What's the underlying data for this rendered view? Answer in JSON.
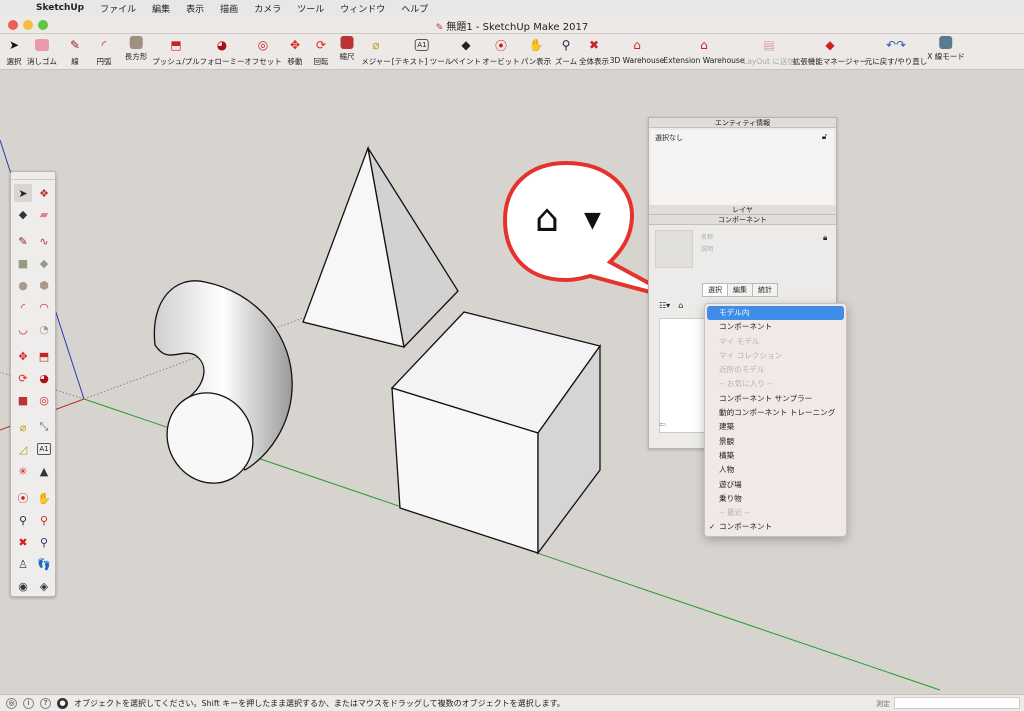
{
  "menubar": {
    "app": "SketchUp",
    "items": [
      "ファイル",
      "編集",
      "表示",
      "描画",
      "カメラ",
      "ツール",
      "ウィンドウ",
      "ヘルプ"
    ]
  },
  "window": {
    "title": "無題1 - SketchUp Make 2017"
  },
  "toolbar": {
    "tools": [
      {
        "label": "選択",
        "icon": "select-arrow-icon"
      },
      {
        "label": "消しゴム",
        "icon": "eraser-icon"
      },
      {
        "label": "線",
        "icon": "pencil-icon"
      },
      {
        "label": "円弧",
        "icon": "arc-icon"
      },
      {
        "label": "長方形",
        "icon": "rectangle-icon"
      },
      {
        "label": "プッシュ/プル",
        "icon": "push-pull-icon"
      },
      {
        "label": "フォローミー",
        "icon": "follow-me-icon"
      },
      {
        "label": "オフセット",
        "icon": "offset-icon"
      },
      {
        "label": "移動",
        "icon": "move-icon"
      },
      {
        "label": "回転",
        "icon": "rotate-icon"
      },
      {
        "label": "縮尺",
        "icon": "scale-icon"
      },
      {
        "label": "メジャー",
        "icon": "tape-measure-icon"
      },
      {
        "label": "[テキスト] ツール",
        "icon": "text-tool-icon"
      },
      {
        "label": "ペイント",
        "icon": "paint-bucket-icon"
      },
      {
        "label": "オービット",
        "icon": "orbit-icon"
      },
      {
        "label": "パン表示",
        "icon": "pan-icon"
      },
      {
        "label": "ズーム",
        "icon": "zoom-icon"
      },
      {
        "label": "全体表示",
        "icon": "zoom-extents-icon"
      },
      {
        "label": "3D Warehouse",
        "icon": "warehouse-icon"
      },
      {
        "label": "Extension Warehouse",
        "icon": "extension-warehouse-icon"
      },
      {
        "label": "LayOut に送信",
        "icon": "layout-icon"
      },
      {
        "label": "拡張機能マネージャー",
        "icon": "extension-manager-icon"
      },
      {
        "label": "元に戻す/やり直し",
        "icon": "undo-redo-icon"
      },
      {
        "label": "X 線モード",
        "icon": "xray-icon"
      }
    ]
  },
  "tray": {
    "entity_info": {
      "title": "エンティティ情報",
      "selection": "選択なし"
    },
    "layers": {
      "title": "レイヤ"
    },
    "components": {
      "title": "コンポーネント",
      "name_placeholder": "名称",
      "desc_placeholder": "説明",
      "tabs": [
        "選択",
        "編集",
        "統計"
      ],
      "active_tab": "選択"
    }
  },
  "dropdown": {
    "items": [
      {
        "label": "モデル内",
        "state": "highlighted"
      },
      {
        "label": "コンポーネント",
        "state": "normal"
      },
      {
        "label": "マイ モデル",
        "state": "disabled"
      },
      {
        "label": "マイ コレクション",
        "state": "disabled"
      },
      {
        "label": "近所のモデル",
        "state": "disabled"
      },
      {
        "label": "-- お気に入り --",
        "state": "disabled"
      },
      {
        "label": "コンポーネント サンプラー",
        "state": "normal"
      },
      {
        "label": "動的コンポーネント トレーニング",
        "state": "normal"
      },
      {
        "label": "建築",
        "state": "normal"
      },
      {
        "label": "景観",
        "state": "normal"
      },
      {
        "label": "構築",
        "state": "normal"
      },
      {
        "label": "人物",
        "state": "normal"
      },
      {
        "label": "遊び場",
        "state": "normal"
      },
      {
        "label": "乗り物",
        "state": "normal"
      },
      {
        "label": "-- 最近 --",
        "state": "disabled"
      },
      {
        "label": "コンポーネント",
        "state": "checked"
      }
    ]
  },
  "status": {
    "message": "オブジェクトを選択してください。Shift キーを押したまま選択するか、またはマウスをドラッグして複数のオブジェクトを選択します。",
    "measure_label": "測定"
  },
  "colors": {
    "callout_red": "#e5322d",
    "highlight_blue": "#3f8de6",
    "axis_green": "#2a9a2a",
    "axis_red": "#c62828",
    "axis_blue": "#2a3ab8"
  }
}
